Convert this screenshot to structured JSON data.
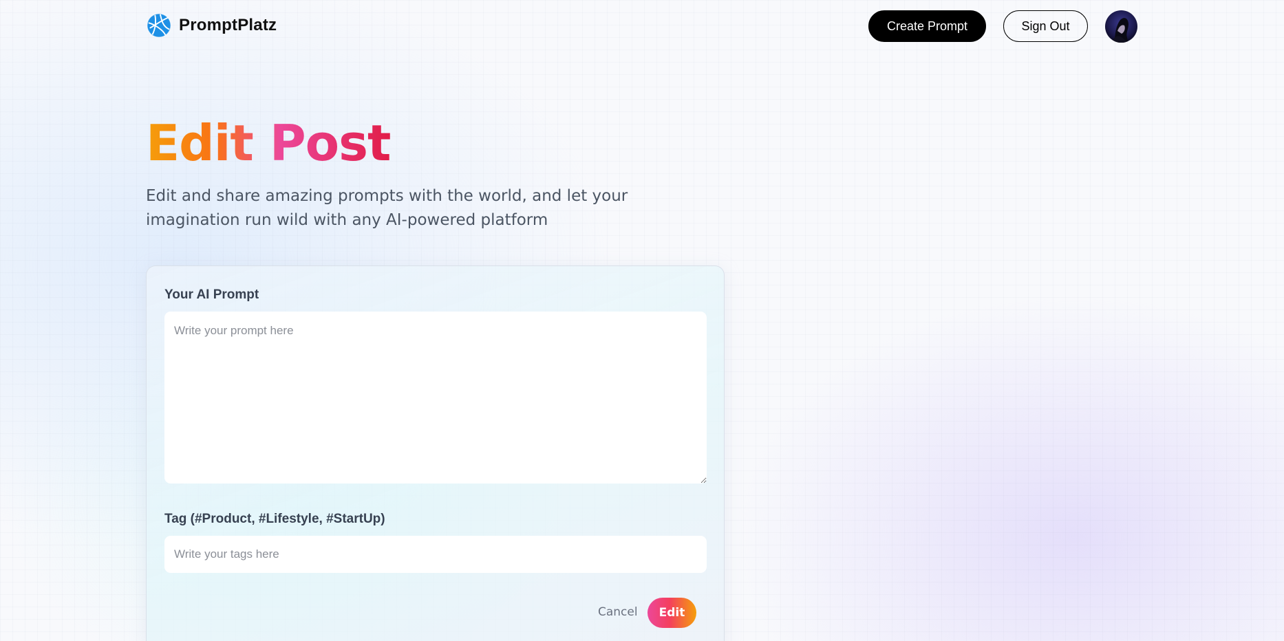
{
  "nav": {
    "brand_name": "PromptPlatz",
    "logo_icon": "globe-icon",
    "create_label": "Create Prompt",
    "signout_label": "Sign Out",
    "avatar_icon": "user-avatar"
  },
  "hero": {
    "title": "Edit Post",
    "description": "Edit and share amazing prompts with the world, and let your imagination run wild with any AI-powered platform"
  },
  "form": {
    "prompt_label": "Your AI Prompt",
    "prompt_value": "",
    "prompt_placeholder": "Write your prompt here",
    "tag_label": "Tag (#Product, #Lifestyle, #StartUp)",
    "tag_value": "",
    "tag_placeholder": "Write your tags here",
    "cancel_label": "Cancel",
    "submit_label": "Edit"
  },
  "colors": {
    "primary_button": "#000000",
    "title_gradient_start": "#f59e0b",
    "title_gradient_end": "#e11d48",
    "edit_button_gradient_start": "#ec4899",
    "edit_button_gradient_end": "#f59e0b",
    "logo_blue": "#1e90e6"
  }
}
